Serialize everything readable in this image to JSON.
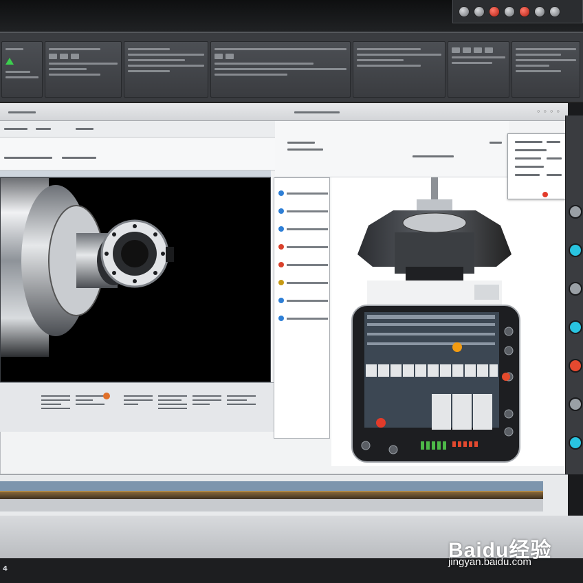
{
  "ribbon": {
    "groups": [
      {
        "id": "run"
      },
      {
        "id": "tools"
      },
      {
        "id": "setup"
      },
      {
        "id": "program"
      },
      {
        "id": "simulation"
      },
      {
        "id": "output"
      },
      {
        "id": "view"
      }
    ]
  },
  "viewport": {
    "subject": "spindle-chuck",
    "background": "#000000"
  },
  "controller": {
    "subject": "cnc-control-pendant",
    "accent": "#f39c12",
    "status_led": "#e23b2a"
  },
  "side_panel": {
    "item_colors": [
      "#2e7fd6",
      "#2e7fd6",
      "#2e7fd6",
      "#d9412b",
      "#d9412b",
      "#c79a14",
      "#2e7fd6",
      "#2e7fd6"
    ]
  },
  "right_strip": {
    "button_colors": [
      "#9aa0a6",
      "#29c4e0",
      "#9aa0a6",
      "#29c4e0",
      "#e5492f",
      "#9aa0a6",
      "#29c4e0"
    ]
  },
  "footer": {
    "corner_label": "4"
  },
  "watermark": {
    "brand": "Baidu经验",
    "url": "jingyan.baidu.com"
  },
  "colors": {
    "ribbon_bg": "#3a3c40",
    "window_bg": "#f2f3f4",
    "accent_green": "#3ccf4e",
    "accent_cyan": "#29c4e0"
  }
}
